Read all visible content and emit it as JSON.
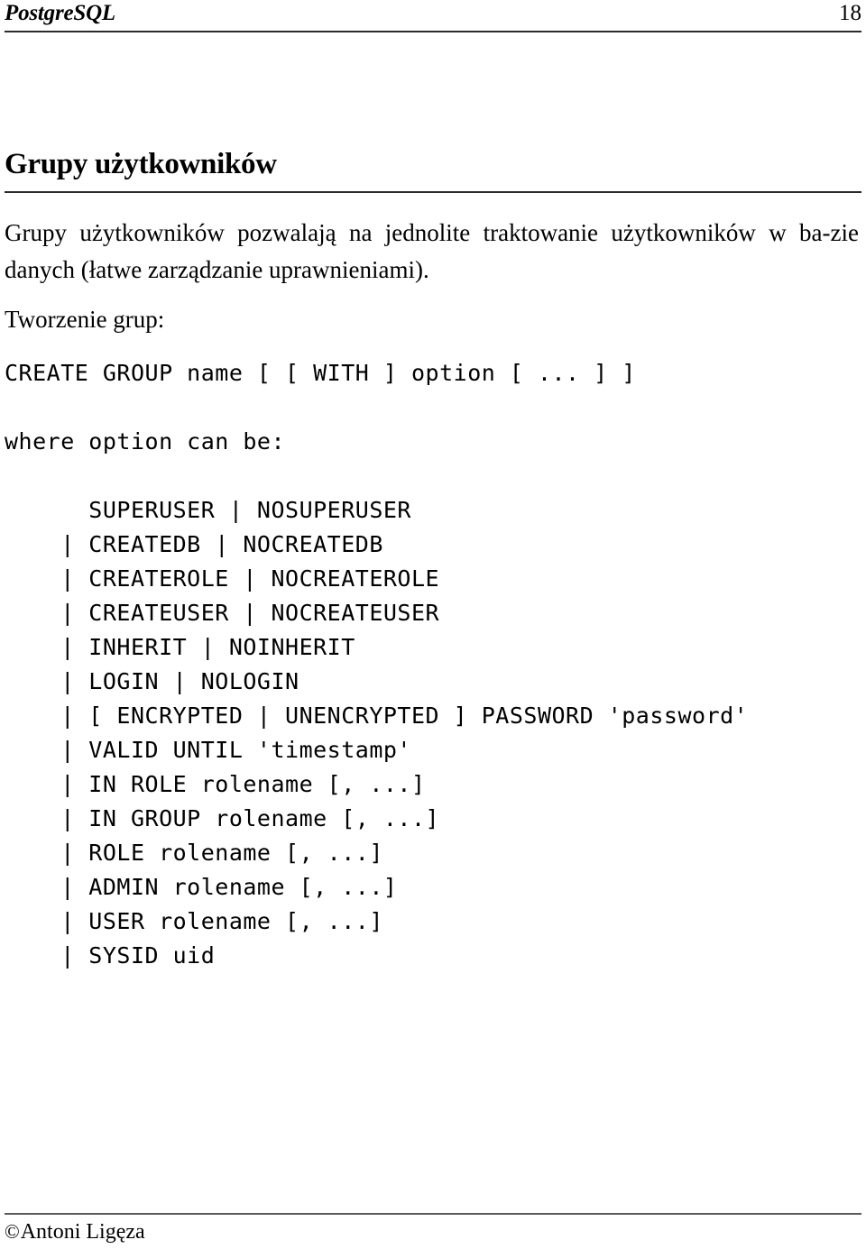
{
  "header": {
    "title": "PostgreSQL",
    "page_number": "18"
  },
  "slide": {
    "title": "Grupy użytkowników",
    "paragraphs": [
      "Grupy użytkowników pozwalają na jednolite traktowanie użytkowników w ba-zie danych (łatwe zarządzanie uprawnieniami).",
      "Tworzenie grup:"
    ]
  },
  "code": {
    "signature": "CREATE GROUP name [ [ WITH ] option [ ... ] ]",
    "where_clause": "where option can be:",
    "options": [
      "      SUPERUSER | NOSUPERUSER",
      "    | CREATEDB | NOCREATEDB",
      "    | CREATEROLE | NOCREATEROLE",
      "    | CREATEUSER | NOCREATEUSER",
      "    | INHERIT | NOINHERIT",
      "    | LOGIN | NOLOGIN",
      "    | [ ENCRYPTED | UNENCRYPTED ] PASSWORD 'password'",
      "    | VALID UNTIL 'timestamp'",
      "    | IN ROLE rolename [, ...]",
      "    | IN GROUP rolename [, ...]",
      "    | ROLE rolename [, ...]",
      "    | ADMIN rolename [, ...]",
      "    | USER rolename [, ...]",
      "    | SYSID uid"
    ]
  },
  "footer": {
    "copyright_symbol": "©",
    "author": "Antoni Ligęza"
  }
}
